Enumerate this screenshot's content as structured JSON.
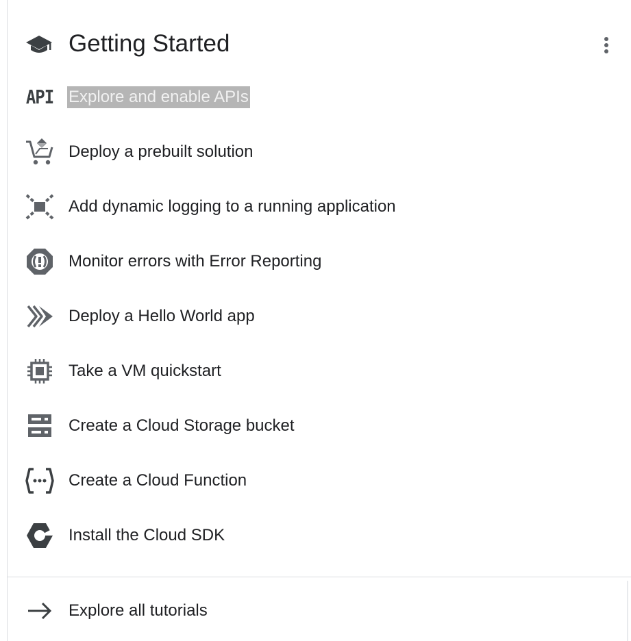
{
  "header": {
    "title": "Getting Started",
    "icon": "school-icon",
    "more_icon": "more-vert-icon"
  },
  "items": [
    {
      "label": "Explore and enable APIs",
      "icon": "api-icon",
      "selected": true
    },
    {
      "label": "Deploy a prebuilt solution",
      "icon": "cart-icon"
    },
    {
      "label": "Add dynamic logging to a running application",
      "icon": "debugger-icon"
    },
    {
      "label": "Monitor errors with Error Reporting",
      "icon": "error-reporting-icon"
    },
    {
      "label": "Deploy a Hello World app",
      "icon": "app-engine-icon"
    },
    {
      "label": "Take a VM quickstart",
      "icon": "compute-engine-icon"
    },
    {
      "label": "Create a Cloud Storage bucket",
      "icon": "storage-icon"
    },
    {
      "label": "Create a Cloud Function",
      "icon": "cloud-functions-icon"
    },
    {
      "label": "Install the Cloud SDK",
      "icon": "cloud-sdk-icon"
    }
  ],
  "footer": {
    "label": "Explore all tutorials",
    "icon": "arrow-forward-icon"
  },
  "colors": {
    "icon": "#5f6368",
    "text": "#202124",
    "selection": "#b5b5b5",
    "divider": "#dadce0"
  }
}
